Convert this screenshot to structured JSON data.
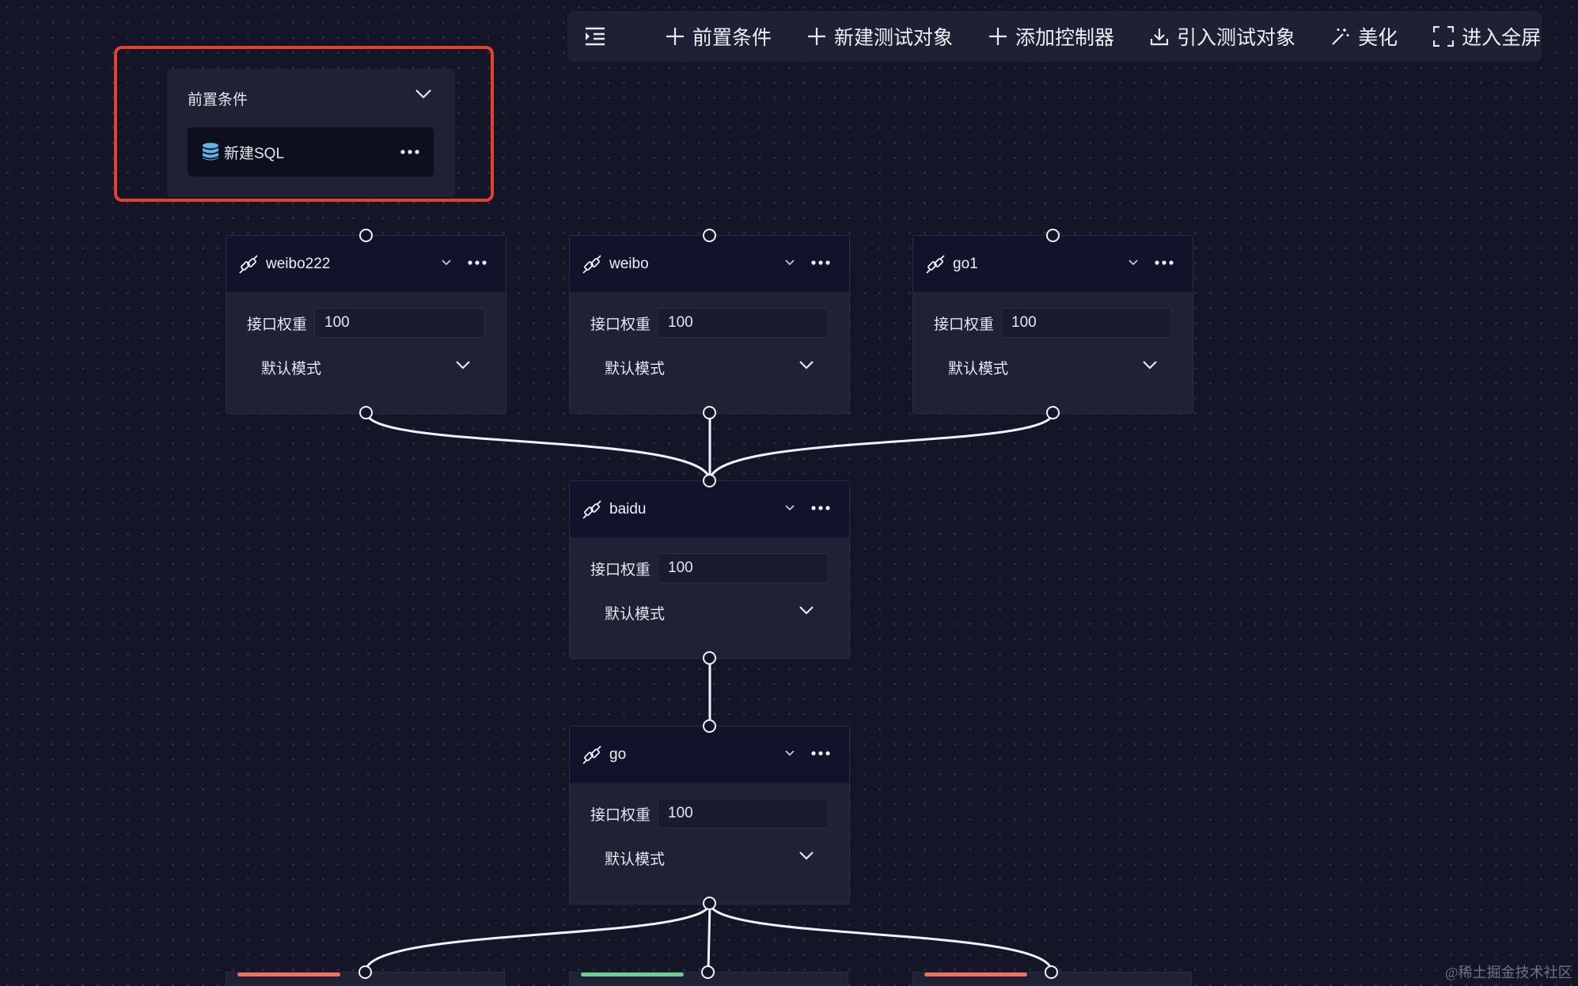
{
  "toolbar": {
    "items": [
      {
        "label": "前置条件",
        "icon": "plus-icon"
      },
      {
        "label": "新建测试对象",
        "icon": "plus-icon"
      },
      {
        "label": "添加控制器",
        "icon": "plus-icon"
      },
      {
        "label": "引入测试对象",
        "icon": "download-icon"
      },
      {
        "label": "美化",
        "icon": "magic-wand-icon"
      },
      {
        "label": "进入全屏",
        "icon": "fullscreen-icon"
      }
    ]
  },
  "precondition": {
    "title": "前置条件",
    "item_label": "新建SQL"
  },
  "nodes": [
    {
      "name": "weibo222",
      "weight_label": "接口权重",
      "weight": "100",
      "mode": "默认模式"
    },
    {
      "name": "weibo",
      "weight_label": "接口权重",
      "weight": "100",
      "mode": "默认模式"
    },
    {
      "name": "go1",
      "weight_label": "接口权重",
      "weight": "100",
      "mode": "默认模式"
    },
    {
      "name": "baidu",
      "weight_label": "接口权重",
      "weight": "100",
      "mode": "默认模式"
    },
    {
      "name": "go",
      "weight_label": "接口权重",
      "weight": "100",
      "mode": "默认模式"
    }
  ],
  "colors": {
    "background": "#141527",
    "node_body": "#1f2134",
    "node_header": "#12132a",
    "highlight": "#e2412f",
    "db_icon": "#5fb3e8",
    "accent_red": "#f0725c",
    "accent_green": "#6fd08c"
  },
  "watermark": "@稀土掘金技术社区"
}
